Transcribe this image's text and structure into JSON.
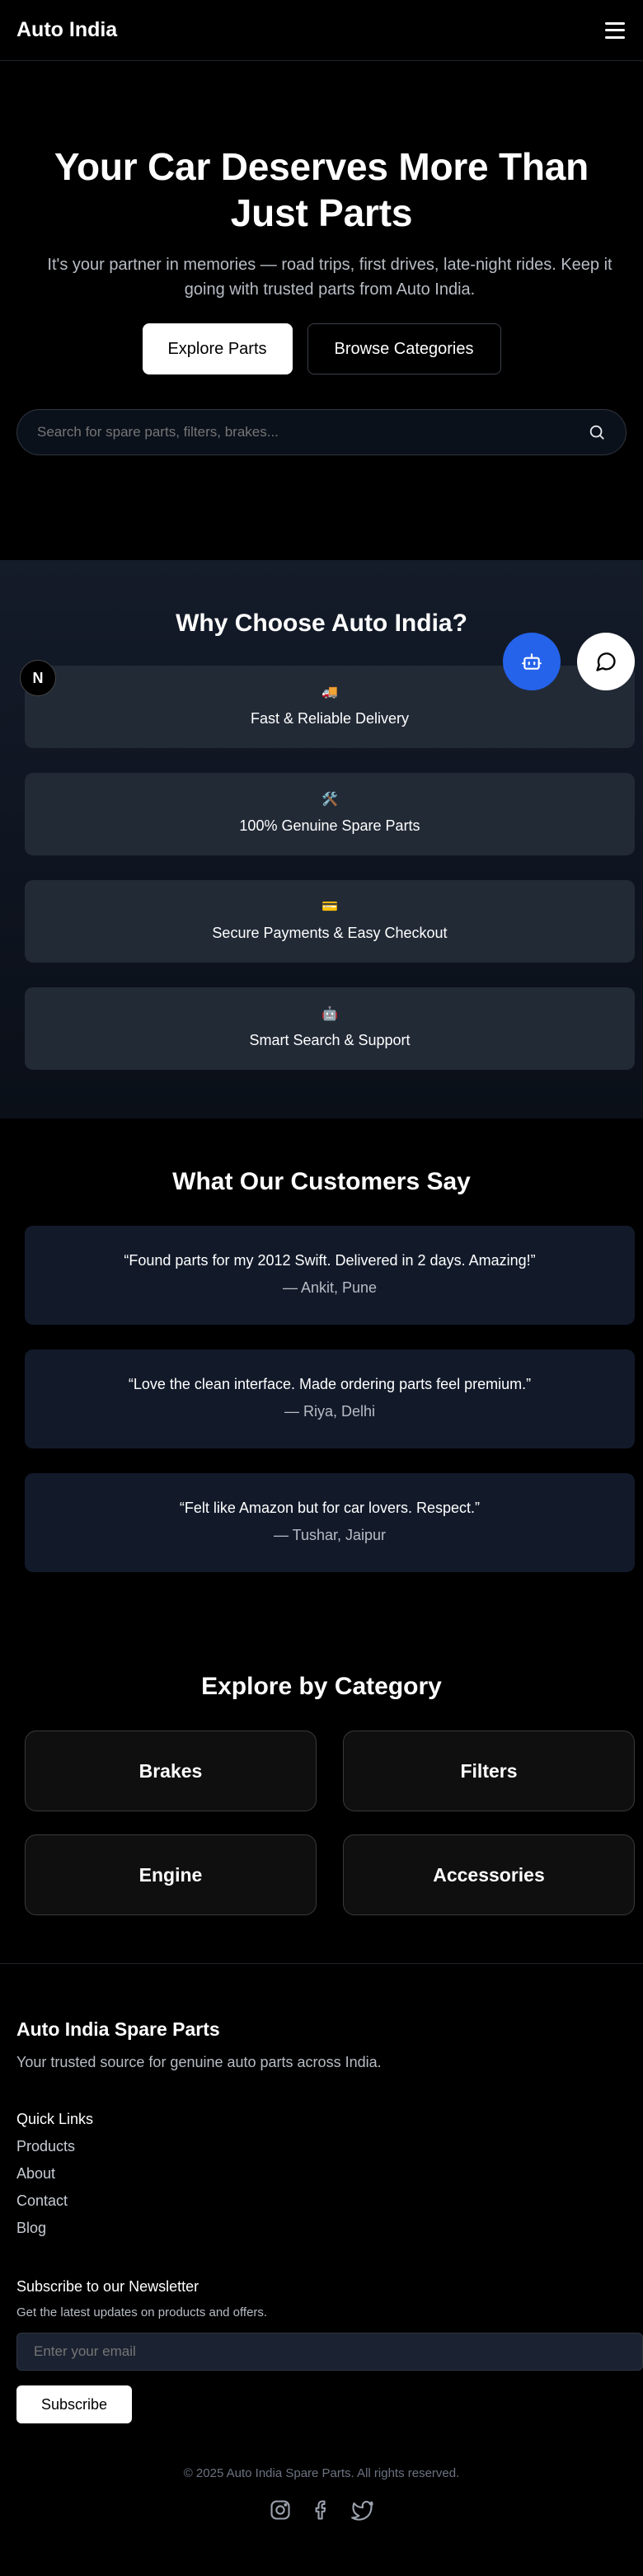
{
  "header": {
    "brand": "Auto India"
  },
  "hero": {
    "title": "Your Car Deserves More Than Just Parts",
    "subtitle": "It's your partner in memories — road trips, first drives, late-night rides. Keep it going with trusted parts from Auto India.",
    "primary_label": "Explore Parts",
    "secondary_label": "Browse Categories"
  },
  "search": {
    "placeholder": "Search for spare parts, filters, brakes..."
  },
  "why": {
    "title": "Why Choose Auto India?",
    "items": [
      {
        "icon": "🚚",
        "label": "Fast & Reliable Delivery"
      },
      {
        "icon": "🛠️",
        "label": "100% Genuine Spare Parts"
      },
      {
        "icon": "💳",
        "label": "Secure Payments & Easy Checkout"
      },
      {
        "icon": "🤖",
        "label": "Smart Search & Support"
      }
    ]
  },
  "badge": {
    "letter": "N"
  },
  "testimonials": {
    "title": "What Our Customers Say",
    "items": [
      {
        "quote": "“Found parts for my 2012 Swift. Delivered in 2 days. Amazing!”",
        "author": "— Ankit, Pune"
      },
      {
        "quote": "“Love the clean interface. Made ordering parts feel premium.”",
        "author": "— Riya, Delhi"
      },
      {
        "quote": "“Felt like Amazon but for car lovers. Respect.”",
        "author": "— Tushar, Jaipur"
      }
    ]
  },
  "categories": {
    "title": "Explore by Category",
    "items": [
      "Brakes",
      "Filters",
      "Engine",
      "Accessories"
    ]
  },
  "footer": {
    "title": "Auto India Spare Parts",
    "tagline": "Your trusted source for genuine auto parts across India.",
    "quick_links_title": "Quick Links",
    "links": [
      "Products",
      "About",
      "Contact",
      "Blog"
    ],
    "newsletter_title": "Subscribe to our Newsletter",
    "newsletter_sub": "Get the latest updates on products and offers.",
    "email_placeholder": "Enter your email",
    "subscribe_label": "Subscribe",
    "copyright": "© 2025 Auto India Spare Parts. All rights reserved."
  },
  "colors": {
    "accent": "#2563eb",
    "card": "#222a36",
    "testimonial_card": "#121a2a"
  }
}
